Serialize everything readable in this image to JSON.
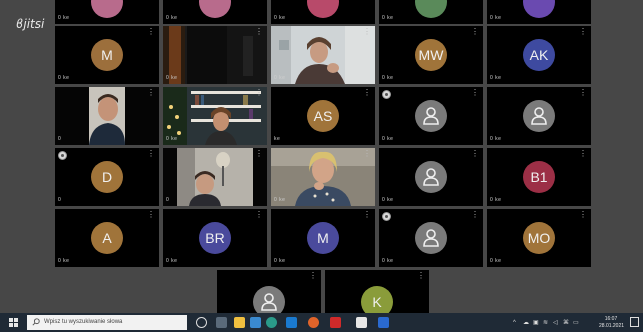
{
  "app": {
    "logo_text": "jitsi"
  },
  "tiles": [
    {
      "id": "t01",
      "avatar": "",
      "indicator": "0 ke",
      "kind": "top-cut",
      "color": "#b86b8c"
    },
    {
      "id": "t02",
      "avatar": "",
      "indicator": "0 ke",
      "kind": "top-cut",
      "color": "#7a5a3a"
    },
    {
      "id": "t03",
      "avatar": "",
      "indicator": "0 ke",
      "kind": "top-cut",
      "color": "#b84a6a"
    },
    {
      "id": "t04",
      "avatar": "",
      "indicator": "0 ke",
      "kind": "top-cut",
      "color": "#5a8a5a"
    },
    {
      "id": "t05",
      "avatar": "",
      "indicator": "0 ke",
      "kind": "top-cut",
      "color": "#6a4ab0"
    },
    {
      "id": "m",
      "avatar": "M",
      "indicator": "0 ke",
      "color": "#9c6f3c"
    },
    {
      "id": "cam-door",
      "avatar": "",
      "indicator": "0 ke",
      "kind": "camera"
    },
    {
      "id": "cam-woman1",
      "avatar": "",
      "indicator": "0 ke",
      "kind": "camera"
    },
    {
      "id": "mw",
      "avatar": "MW",
      "indicator": "0 ke",
      "color": "#a0743a"
    },
    {
      "id": "ak",
      "avatar": "AK",
      "indicator": "0 ke",
      "color": "#3e4aa0"
    },
    {
      "id": "cam-man",
      "avatar": "",
      "indicator": "0",
      "kind": "camera"
    },
    {
      "id": "cam-shelf",
      "avatar": "",
      "indicator": "0 ke",
      "kind": "camera"
    },
    {
      "id": "as",
      "avatar": "AS",
      "indicator": "ke",
      "color": "#a0743a"
    },
    {
      "id": "gray1",
      "avatar": "",
      "indicator": "0 ke",
      "kind": "gray",
      "rec": true
    },
    {
      "id": "gray2",
      "avatar": "",
      "indicator": "0 ke",
      "kind": "gray"
    },
    {
      "id": "d",
      "avatar": "D",
      "indicator": "0",
      "color": "#a0743a",
      "rec": true
    },
    {
      "id": "cam-lamp",
      "avatar": "",
      "indicator": "0",
      "kind": "camera"
    },
    {
      "id": "cam-blonde",
      "avatar": "",
      "indicator": "0 ke",
      "kind": "camera"
    },
    {
      "id": "gray3",
      "avatar": "",
      "indicator": "0 ke",
      "kind": "gray"
    },
    {
      "id": "b1",
      "avatar": "B1",
      "indicator": "0 ke",
      "color": "#9c2f46"
    },
    {
      "id": "a",
      "avatar": "A",
      "indicator": "0 ke",
      "color": "#a0743a"
    },
    {
      "id": "br",
      "avatar": "BR",
      "indicator": "0 ke",
      "color": "#4a4a9c"
    },
    {
      "id": "m2",
      "avatar": "M",
      "indicator": "0 ke",
      "color": "#4a4a9c"
    },
    {
      "id": "gray4",
      "avatar": "",
      "indicator": "0 ke",
      "kind": "gray",
      "rec": true
    },
    {
      "id": "mo",
      "avatar": "MO",
      "indicator": "0 ke",
      "color": "#a0743a"
    },
    {
      "id": "gray5",
      "avatar": "",
      "indicator": "",
      "kind": "gray"
    },
    {
      "id": "k",
      "avatar": "K",
      "indicator": "",
      "color": "#8a9c3a"
    }
  ],
  "taskbar": {
    "search_placeholder": "Wpisz tu wyszukiwanie słowa",
    "time": "16:07",
    "date": "28.01.2021",
    "tray_icons": [
      "chevron-up-icon",
      "cloud-icon",
      "network-icon",
      "wifi-icon",
      "volume-icon",
      "language-icon"
    ]
  }
}
